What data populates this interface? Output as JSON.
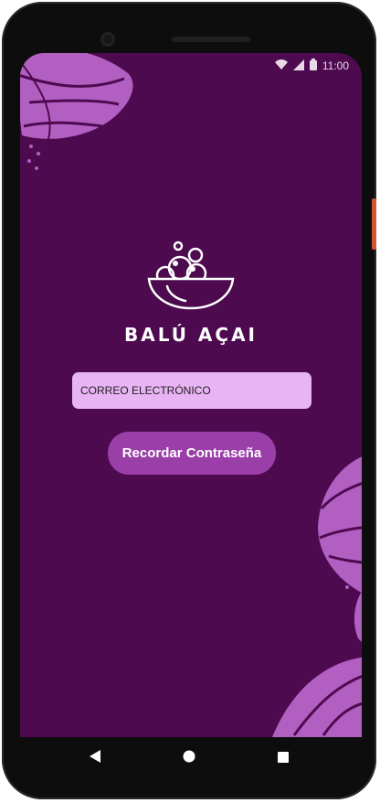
{
  "status_bar": {
    "time": "11:00",
    "icons": [
      "wifi-icon",
      "signal-icon",
      "battery-icon"
    ]
  },
  "app": {
    "brand_name": "BALÚ AÇAI",
    "logo_icon": "acai-bowl-icon"
  },
  "form": {
    "email_placeholder": "CORREO ELECTRÓNICO",
    "submit_label": "Recordar Contraseña"
  },
  "nav_bar": {
    "buttons": [
      "back-icon",
      "home-icon",
      "recents-icon"
    ]
  },
  "colors": {
    "background": "#4d0a4f",
    "input": "#e9b4f4",
    "button": "#9a3fa8",
    "leaf": "#b25fc2"
  }
}
